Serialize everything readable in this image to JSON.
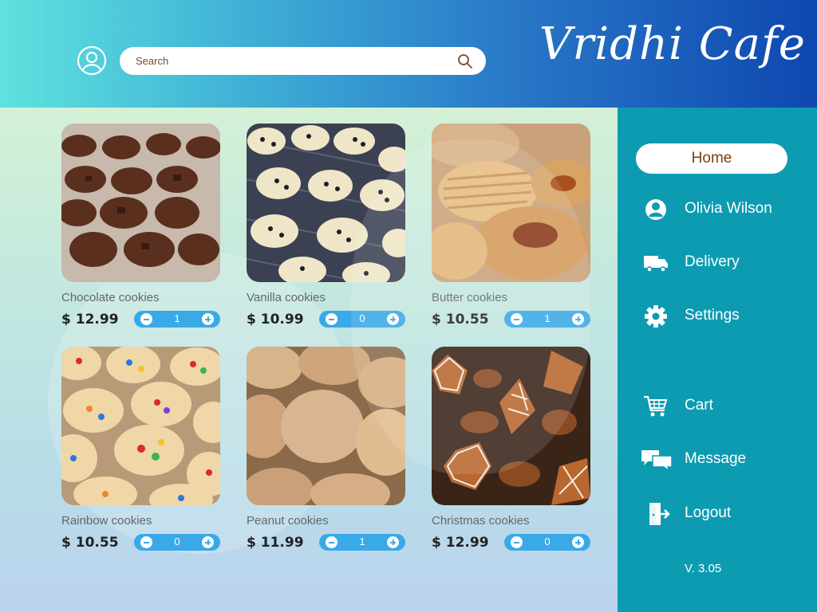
{
  "header": {
    "brand": "Vridhi Cafe",
    "search": {
      "placeholder": "Search",
      "value": ""
    }
  },
  "products": [
    {
      "name": "Chocolate cookies",
      "price": "$ 12.99",
      "quantity": "1"
    },
    {
      "name": "Vanilla cookies",
      "price": "$ 10.99",
      "quantity": "0"
    },
    {
      "name": "Butter cookies",
      "price": "$ 10.55",
      "quantity": "1"
    },
    {
      "name": "Rainbow cookies",
      "price": "$ 10.55",
      "quantity": "0"
    },
    {
      "name": "Peanut cookies",
      "price": "$ 11.99",
      "quantity": "1"
    },
    {
      "name": "Christmas cookies",
      "price": "$ 12.99",
      "quantity": "0"
    }
  ],
  "sidebar": {
    "home_label": "Home",
    "items": [
      {
        "label": "Olivia Wilson",
        "icon": "user-icon"
      },
      {
        "label": "Delivery",
        "icon": "truck-icon"
      },
      {
        "label": "Settings",
        "icon": "gear-icon"
      },
      {
        "label": "Cart",
        "icon": "cart-icon"
      },
      {
        "label": "Message",
        "icon": "message-icon"
      },
      {
        "label": "Logout",
        "icon": "logout-icon"
      }
    ],
    "version": "V. 3.05"
  },
  "colors": {
    "accent": "#3aa9e8",
    "sidebar": "#0d9bb2",
    "home_text": "#7a3f12"
  }
}
